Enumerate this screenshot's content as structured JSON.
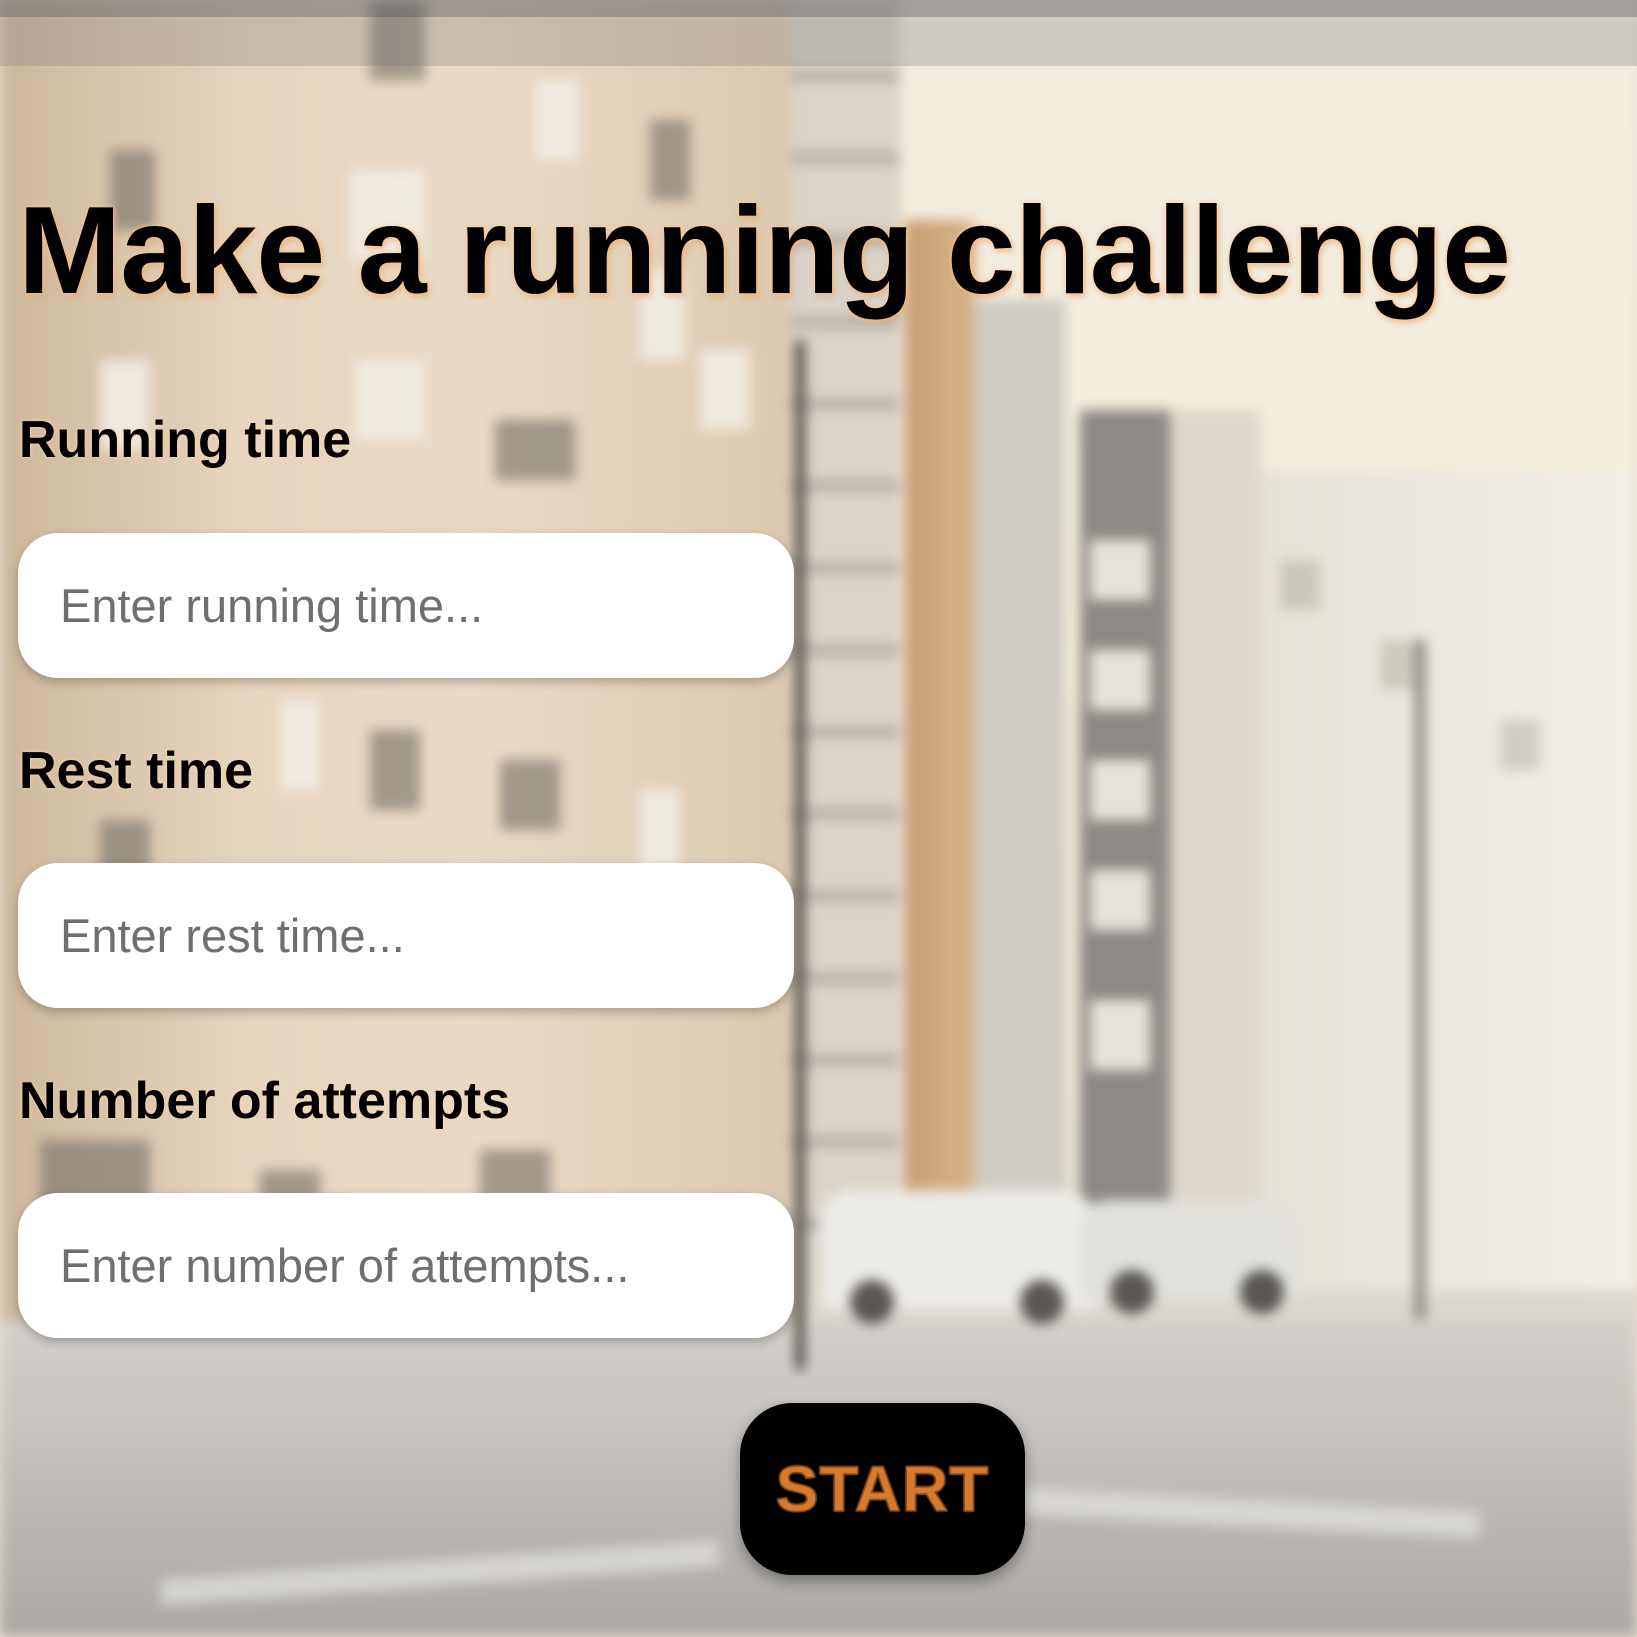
{
  "page": {
    "title": "Make a running challenge"
  },
  "form": {
    "running_time": {
      "label": "Running time",
      "placeholder": "Enter running time...",
      "value": ""
    },
    "rest_time": {
      "label": "Rest time",
      "placeholder": "Enter rest time...",
      "value": ""
    },
    "attempts": {
      "label": "Number of attempts",
      "placeholder": "Enter number of attempts...",
      "value": ""
    }
  },
  "actions": {
    "start_label": "START"
  },
  "colors": {
    "accent": "#d87a2e",
    "button_bg": "#000000",
    "input_bg": "#ffffff",
    "placeholder": "#6f6f6f"
  }
}
